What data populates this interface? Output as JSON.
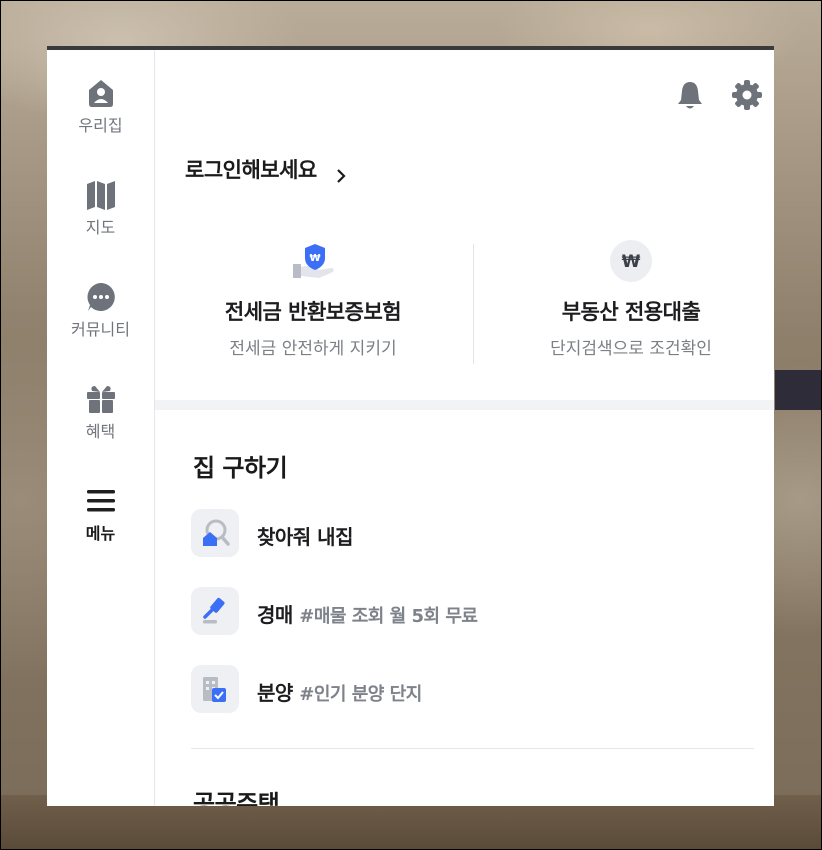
{
  "sidebar": {
    "items": [
      {
        "label": "우리집",
        "icon": "house-icon"
      },
      {
        "label": "지도",
        "icon": "map-icon"
      },
      {
        "label": "커뮤니티",
        "icon": "chat-bubble-icon"
      },
      {
        "label": "혜택",
        "icon": "gift-icon"
      },
      {
        "label": "메뉴",
        "icon": "hamburger-menu-icon",
        "active": true
      }
    ]
  },
  "header": {
    "icons": [
      "bell-icon",
      "gear-icon"
    ],
    "login_text": "로그인해보세요"
  },
  "promos": [
    {
      "title": "전세금 반환보증보험",
      "subtitle": "전세금 안전하게 지키기",
      "icon": "shield-won-hand-icon"
    },
    {
      "title": "부동산 전용대출",
      "subtitle": "단지검색으로 조건확인",
      "icon": "won-coin-icon"
    }
  ],
  "find_home": {
    "title": "집 구하기",
    "items": [
      {
        "label": "찾아줘 내집",
        "tag": "",
        "icon": "house-search-icon"
      },
      {
        "label": "경매",
        "tag": "#매물 조회 월 5회 무료",
        "icon": "gavel-icon"
      },
      {
        "label": "분양",
        "tag": "#인기 분양 단지",
        "icon": "building-check-icon"
      }
    ]
  },
  "public_housing": {
    "title": "공공주택"
  },
  "colors": {
    "accent": "#3b6ff5",
    "icon_gray": "#6e737b",
    "panel_top_bar": "#3a3a3e"
  }
}
